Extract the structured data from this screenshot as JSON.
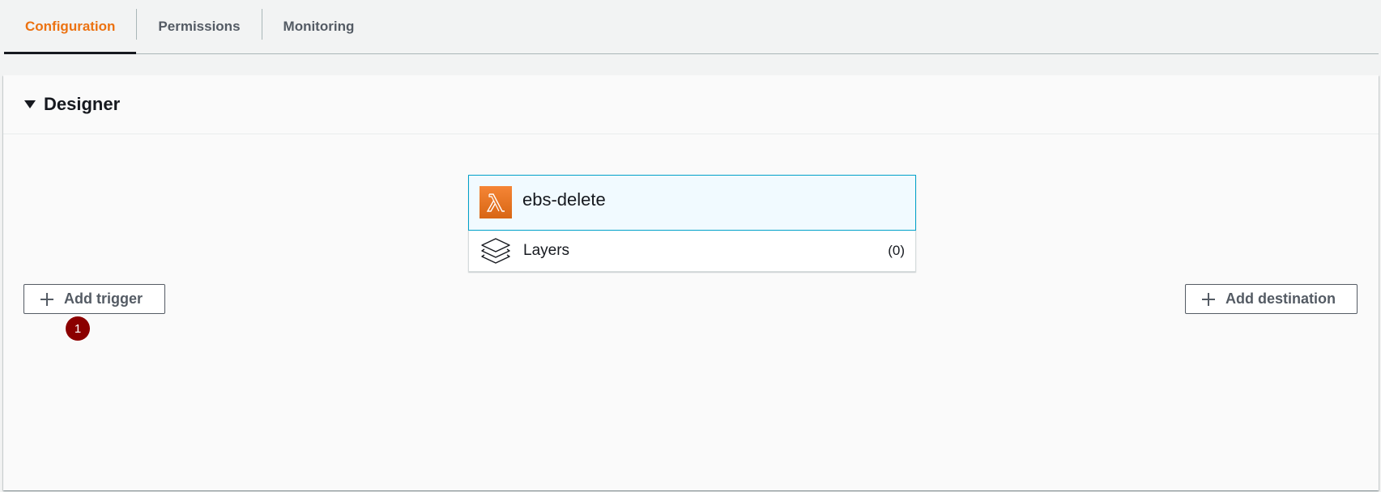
{
  "tabs": [
    {
      "label": "Configuration",
      "active": true
    },
    {
      "label": "Permissions",
      "active": false
    },
    {
      "label": "Monitoring",
      "active": false
    }
  ],
  "designer": {
    "title": "Designer",
    "function": {
      "name": "ebs-delete",
      "icon": "lambda-icon"
    },
    "layers": {
      "label": "Layers",
      "count": "(0)",
      "icon": "layers-icon"
    },
    "add_trigger_label": "Add trigger",
    "add_destination_label": "Add destination",
    "badge": "1"
  },
  "colors": {
    "accent": "#ec7211",
    "lambda": "#d86613",
    "selected_border": "#00a1c9",
    "selected_bg": "#f1faff",
    "badge": "#8b0000"
  }
}
